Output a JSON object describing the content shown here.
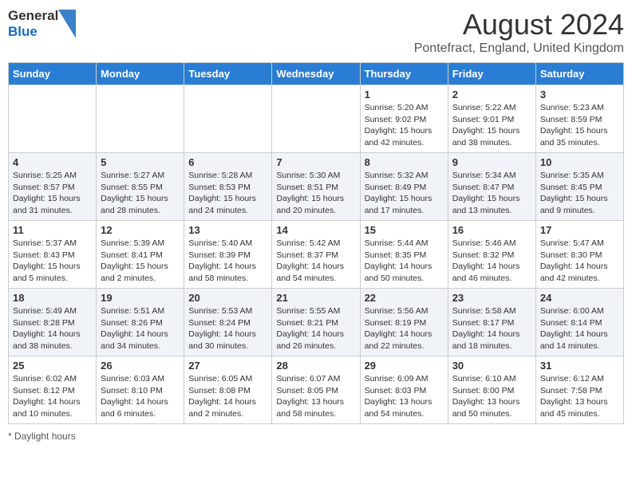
{
  "header": {
    "logo_general": "General",
    "logo_blue": "Blue",
    "month_year": "August 2024",
    "location": "Pontefract, England, United Kingdom"
  },
  "days_of_week": [
    "Sunday",
    "Monday",
    "Tuesday",
    "Wednesday",
    "Thursday",
    "Friday",
    "Saturday"
  ],
  "weeks": [
    [
      {
        "day": "",
        "info": ""
      },
      {
        "day": "",
        "info": ""
      },
      {
        "day": "",
        "info": ""
      },
      {
        "day": "",
        "info": ""
      },
      {
        "day": "1",
        "info": "Sunrise: 5:20 AM\nSunset: 9:02 PM\nDaylight: 15 hours and 42 minutes."
      },
      {
        "day": "2",
        "info": "Sunrise: 5:22 AM\nSunset: 9:01 PM\nDaylight: 15 hours and 38 minutes."
      },
      {
        "day": "3",
        "info": "Sunrise: 5:23 AM\nSunset: 8:59 PM\nDaylight: 15 hours and 35 minutes."
      }
    ],
    [
      {
        "day": "4",
        "info": "Sunrise: 5:25 AM\nSunset: 8:57 PM\nDaylight: 15 hours and 31 minutes."
      },
      {
        "day": "5",
        "info": "Sunrise: 5:27 AM\nSunset: 8:55 PM\nDaylight: 15 hours and 28 minutes."
      },
      {
        "day": "6",
        "info": "Sunrise: 5:28 AM\nSunset: 8:53 PM\nDaylight: 15 hours and 24 minutes."
      },
      {
        "day": "7",
        "info": "Sunrise: 5:30 AM\nSunset: 8:51 PM\nDaylight: 15 hours and 20 minutes."
      },
      {
        "day": "8",
        "info": "Sunrise: 5:32 AM\nSunset: 8:49 PM\nDaylight: 15 hours and 17 minutes."
      },
      {
        "day": "9",
        "info": "Sunrise: 5:34 AM\nSunset: 8:47 PM\nDaylight: 15 hours and 13 minutes."
      },
      {
        "day": "10",
        "info": "Sunrise: 5:35 AM\nSunset: 8:45 PM\nDaylight: 15 hours and 9 minutes."
      }
    ],
    [
      {
        "day": "11",
        "info": "Sunrise: 5:37 AM\nSunset: 8:43 PM\nDaylight: 15 hours and 5 minutes."
      },
      {
        "day": "12",
        "info": "Sunrise: 5:39 AM\nSunset: 8:41 PM\nDaylight: 15 hours and 2 minutes."
      },
      {
        "day": "13",
        "info": "Sunrise: 5:40 AM\nSunset: 8:39 PM\nDaylight: 14 hours and 58 minutes."
      },
      {
        "day": "14",
        "info": "Sunrise: 5:42 AM\nSunset: 8:37 PM\nDaylight: 14 hours and 54 minutes."
      },
      {
        "day": "15",
        "info": "Sunrise: 5:44 AM\nSunset: 8:35 PM\nDaylight: 14 hours and 50 minutes."
      },
      {
        "day": "16",
        "info": "Sunrise: 5:46 AM\nSunset: 8:32 PM\nDaylight: 14 hours and 46 minutes."
      },
      {
        "day": "17",
        "info": "Sunrise: 5:47 AM\nSunset: 8:30 PM\nDaylight: 14 hours and 42 minutes."
      }
    ],
    [
      {
        "day": "18",
        "info": "Sunrise: 5:49 AM\nSunset: 8:28 PM\nDaylight: 14 hours and 38 minutes."
      },
      {
        "day": "19",
        "info": "Sunrise: 5:51 AM\nSunset: 8:26 PM\nDaylight: 14 hours and 34 minutes."
      },
      {
        "day": "20",
        "info": "Sunrise: 5:53 AM\nSunset: 8:24 PM\nDaylight: 14 hours and 30 minutes."
      },
      {
        "day": "21",
        "info": "Sunrise: 5:55 AM\nSunset: 8:21 PM\nDaylight: 14 hours and 26 minutes."
      },
      {
        "day": "22",
        "info": "Sunrise: 5:56 AM\nSunset: 8:19 PM\nDaylight: 14 hours and 22 minutes."
      },
      {
        "day": "23",
        "info": "Sunrise: 5:58 AM\nSunset: 8:17 PM\nDaylight: 14 hours and 18 minutes."
      },
      {
        "day": "24",
        "info": "Sunrise: 6:00 AM\nSunset: 8:14 PM\nDaylight: 14 hours and 14 minutes."
      }
    ],
    [
      {
        "day": "25",
        "info": "Sunrise: 6:02 AM\nSunset: 8:12 PM\nDaylight: 14 hours and 10 minutes."
      },
      {
        "day": "26",
        "info": "Sunrise: 6:03 AM\nSunset: 8:10 PM\nDaylight: 14 hours and 6 minutes."
      },
      {
        "day": "27",
        "info": "Sunrise: 6:05 AM\nSunset: 8:08 PM\nDaylight: 14 hours and 2 minutes."
      },
      {
        "day": "28",
        "info": "Sunrise: 6:07 AM\nSunset: 8:05 PM\nDaylight: 13 hours and 58 minutes."
      },
      {
        "day": "29",
        "info": "Sunrise: 6:09 AM\nSunset: 8:03 PM\nDaylight: 13 hours and 54 minutes."
      },
      {
        "day": "30",
        "info": "Sunrise: 6:10 AM\nSunset: 8:00 PM\nDaylight: 13 hours and 50 minutes."
      },
      {
        "day": "31",
        "info": "Sunrise: 6:12 AM\nSunset: 7:58 PM\nDaylight: 13 hours and 45 minutes."
      }
    ]
  ],
  "footer": {
    "note": "Daylight hours"
  }
}
